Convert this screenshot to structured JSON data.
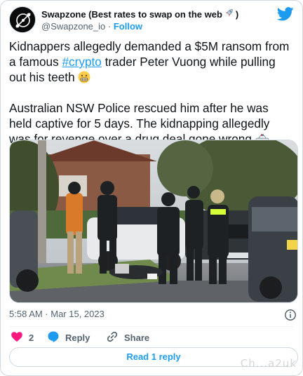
{
  "author": {
    "name": "Swapzone (Best rates to swap on the web",
    "name_suffix": ")",
    "handle": "@Swapzone_io",
    "separator": "·",
    "follow_label": "Follow",
    "avatar_icon": "satellite-logo-icon",
    "verified_emoji_icon": "rocket-icon"
  },
  "platform_icon": "twitter-bird-icon",
  "tweet": {
    "paragraph1_before": "Kidnappers allegedly demanded a $5M ransom from a famous ",
    "hashtag": "#crypto",
    "paragraph1_after": " trader Peter Vuong while pulling out his teeth ",
    "paragraph1_emoji": "grimacing-face-icon",
    "paragraph2": "Australian NSW Police rescued him after he was held captive for 5 days. The kidnapping allegedly was for revenge over a drug deal gone wrong ",
    "paragraph2_emoji": "police-car-icon"
  },
  "media": {
    "photo_icon": "police-raid-photo"
  },
  "meta": {
    "timestamp": "5:58 AM · Mar 15, 2023",
    "info_icon": "info-icon"
  },
  "actions": {
    "like_count": "2",
    "reply_label": "Reply",
    "share_label": "Share"
  },
  "read_replies_label": "Read 1 reply",
  "watermark": "Ch...a2uk",
  "colors": {
    "accent": "#1d9bf0",
    "like_red": "#f91880",
    "muted": "#536471",
    "text": "#0f1419",
    "border": "#cfd9de"
  }
}
